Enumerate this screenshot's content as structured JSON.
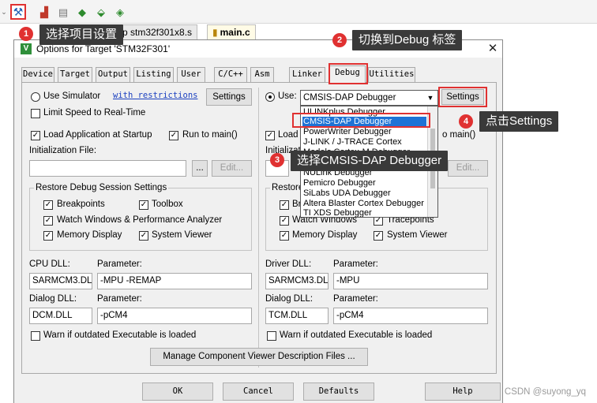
{
  "ide": {
    "toolbar_icons": [
      "options-for-target-icon",
      "manage-components-icon",
      "layers-icon",
      "build-icon",
      "download-icon",
      "stack-icon"
    ],
    "tabs": [
      {
        "label": "p stm32f301x8.s",
        "icon": "file-icon"
      },
      {
        "label": "main.c",
        "icon": "file-icon"
      }
    ]
  },
  "dialog": {
    "title": "Options for Target 'STM32F301'",
    "close_glyph": "✕",
    "tabs": [
      {
        "label": "Device"
      },
      {
        "label": "Target"
      },
      {
        "label": "Output"
      },
      {
        "label": "Listing"
      },
      {
        "label": "User"
      },
      {
        "label": "C/C++"
      },
      {
        "label": "Asm"
      },
      {
        "label": "Linker"
      },
      {
        "label": "Debug"
      },
      {
        "label": "Utilities"
      }
    ],
    "active_tab": "Debug",
    "left": {
      "use_simulator": "Use Simulator",
      "restrictions_link": "with restrictions",
      "settings": "Settings",
      "limit_speed": "Limit Speed to Real-Time",
      "load_app": "Load Application at Startup",
      "run_to_main": "Run to main()",
      "init_file_label": "Initialization File:",
      "init_file_value": "",
      "browse": "...",
      "edit": "Edit...",
      "restore_title": "Restore Debug Session Settings",
      "breakpoints": "Breakpoints",
      "toolbox": "Toolbox",
      "watch_windows": "Watch Windows & Performance Analyzer",
      "memory_display": "Memory Display",
      "system_viewer": "System Viewer",
      "cpu_dll_label": "CPU DLL:",
      "cpu_param_label": "Parameter:",
      "cpu_dll": "SARMCM3.DLL",
      "cpu_param": "-MPU -REMAP",
      "dialog_dll_label": "Dialog DLL:",
      "dialog_param_label": "Parameter:",
      "dialog_dll": "DCM.DLL",
      "dialog_param": "-pCM4",
      "warn": "Warn if outdated Executable is loaded"
    },
    "right": {
      "use": "Use:",
      "debugger_selected": "CMSIS-DAP Debugger",
      "settings": "Settings",
      "debugger_options": [
        "ULINKplus Debugger",
        "CMSIS-DAP Debugger",
        "PowerWriter Debugger",
        "J-LINK / J-TRACE Cortex",
        "Models Cortex-M Debugger",
        "",
        "NULink Debugger",
        "Pemicro Debugger",
        "SiLabs UDA Debugger",
        "Altera Blaster Cortex Debugger",
        "TI XDS Debugger"
      ],
      "load": "Load",
      "run_to_main_partial": "o main()",
      "init_partial": "Initializati",
      "edit": "Edit...",
      "restore_partial": "Restore",
      "breakpoints_partial": "Bre",
      "watch_windows": "Watch Windows",
      "tracepoints": "Tracepoints",
      "memory_display": "Memory Display",
      "system_viewer": "System Viewer",
      "driver_dll_label": "Driver DLL:",
      "driver_param_label": "Parameter:",
      "driver_dll": "SARMCM3.DLL",
      "driver_param": "-MPU",
      "dialog_dll_label": "Dialog DLL:",
      "dialog_param_label": "Parameter:",
      "dialog_dll": "TCM.DLL",
      "dialog_param": "-pCM4",
      "warn": "Warn if outdated Executable is loaded"
    },
    "manage_button": "Manage Component Viewer Description Files ...",
    "footer": {
      "ok": "OK",
      "cancel": "Cancel",
      "defaults": "Defaults",
      "help": "Help"
    }
  },
  "annotations": [
    {
      "number": "1",
      "text": "选择项目设置"
    },
    {
      "number": "2",
      "text": "切换到Debug 标签"
    },
    {
      "number": "3",
      "text": "选择CMSIS-DAP Debugger"
    },
    {
      "number": "4",
      "text": "点击Settings"
    }
  ],
  "watermark": "CSDN @suyong_yq",
  "colors": {
    "highlight": "#e03131",
    "callout_bg": "#3a3a3a",
    "selection": "#1e73d6",
    "link": "#1a3fbf"
  }
}
